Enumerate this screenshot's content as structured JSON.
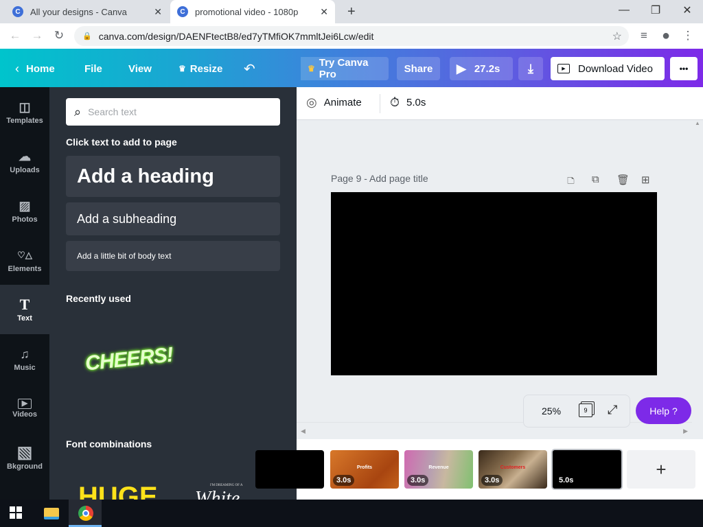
{
  "browser": {
    "tabs": [
      {
        "title": "All your designs - Canva",
        "favicon": "C",
        "active": false
      },
      {
        "title": "promotional video - 1080p",
        "favicon": "C",
        "active": true
      }
    ],
    "new_tab": "+",
    "window_controls": {
      "minimize": "—",
      "maximize": "❐",
      "close": "✕"
    },
    "url": "canva.com/design/DAENFtectB8/ed7yTMfiOK7mmltJei6Lcw/edit"
  },
  "header": {
    "home": "Home",
    "file": "File",
    "view": "View",
    "resize": "Resize",
    "try_pro": "Try Canva Pro",
    "share": "Share",
    "play_duration": "27.2s",
    "download_video": "Download Video",
    "more": "•••"
  },
  "sidebar": {
    "items": [
      {
        "label": "Templates",
        "icon": "templates-icon",
        "glyph": "◫"
      },
      {
        "label": "Uploads",
        "icon": "upload-cloud-icon",
        "glyph": "☁"
      },
      {
        "label": "Photos",
        "icon": "photo-icon",
        "glyph": "▨"
      },
      {
        "label": "Elements",
        "icon": "elements-icon",
        "glyph": "♡△"
      },
      {
        "label": "Text",
        "icon": "text-icon",
        "glyph": "T"
      },
      {
        "label": "Music",
        "icon": "music-icon",
        "glyph": "♫"
      },
      {
        "label": "Videos",
        "icon": "video-icon",
        "glyph": "▶"
      },
      {
        "label": "Bkground",
        "icon": "background-icon",
        "glyph": "▧"
      }
    ],
    "active": "Text"
  },
  "panel": {
    "search_placeholder": "Search text",
    "section_add": "Click text to add to page",
    "heading": "Add a heading",
    "subheading": "Add a subheading",
    "body": "Add a little bit of body text",
    "recently_used": "Recently used",
    "recent_item": "CHEERS!",
    "font_combinations": "Font combinations",
    "combo1": "HUGE",
    "combo2_small": "I'M DREAMING OF A",
    "combo2_script": "White"
  },
  "toolbar": {
    "animate": "Animate",
    "duration": "5.0s"
  },
  "page": {
    "title": "Page 9 - Add page title",
    "background": "#000000"
  },
  "zoom": {
    "level": "25%",
    "page_count": "9"
  },
  "help": "Help  ?",
  "timeline": {
    "thumbs": [
      {
        "duration": "",
        "label": "",
        "color": "#000000"
      },
      {
        "duration": "3.0s",
        "label": "Profits",
        "color": "#c4621a"
      },
      {
        "duration": "3.0s",
        "label": "Revenue",
        "color": "#b88a9a"
      },
      {
        "duration": "3.0s",
        "label": "Customers",
        "color": "#6b5438"
      },
      {
        "duration": "5.0s",
        "label": "",
        "color": "#000000"
      }
    ],
    "add": "+"
  }
}
